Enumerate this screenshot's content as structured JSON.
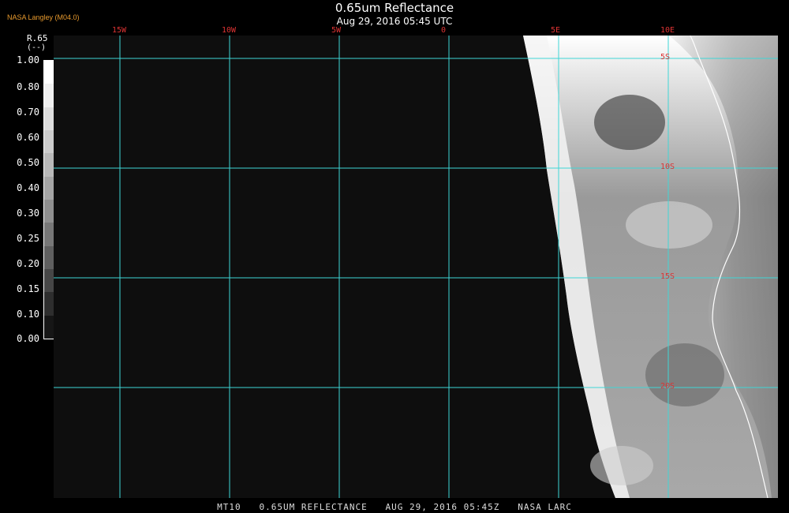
{
  "credit": "NASA Langley (M04.0)",
  "title": "0.65um Reflectance",
  "subtitle": "Aug 29, 2016 05:45 UTC",
  "bottom_caption": "MT10   0.65UM REFLECTANCE   AUG 29, 2016 05:45Z   NASA LARC",
  "legend": {
    "name": "R.65",
    "unit": "(--)",
    "ticks": [
      "1.00",
      "0.80",
      "0.70",
      "0.60",
      "0.50",
      "0.40",
      "0.30",
      "0.25",
      "0.20",
      "0.15",
      "0.10",
      "0.00"
    ],
    "colors": [
      "#ffffff",
      "#f0f0f0",
      "#dedede",
      "#cccccc",
      "#b9b9b9",
      "#a5a5a5",
      "#8f8f8f",
      "#777777",
      "#5f5f5f",
      "#464646",
      "#2e2e2e",
      "#161616"
    ]
  },
  "map": {
    "longitude_labels": [
      "15W",
      "10W",
      "5W",
      "0",
      "5E",
      "10E"
    ],
    "longitudes": [
      -15,
      -10,
      -5,
      0,
      5,
      10
    ],
    "latitude_labels": [
      "5S",
      "10S",
      "15S",
      "20S"
    ],
    "latitudes": [
      -5,
      -10,
      -15,
      -20
    ],
    "gridline_color": "#3fd6d6",
    "label_color": "#dd3333",
    "coastline_color": "#ffffff"
  }
}
